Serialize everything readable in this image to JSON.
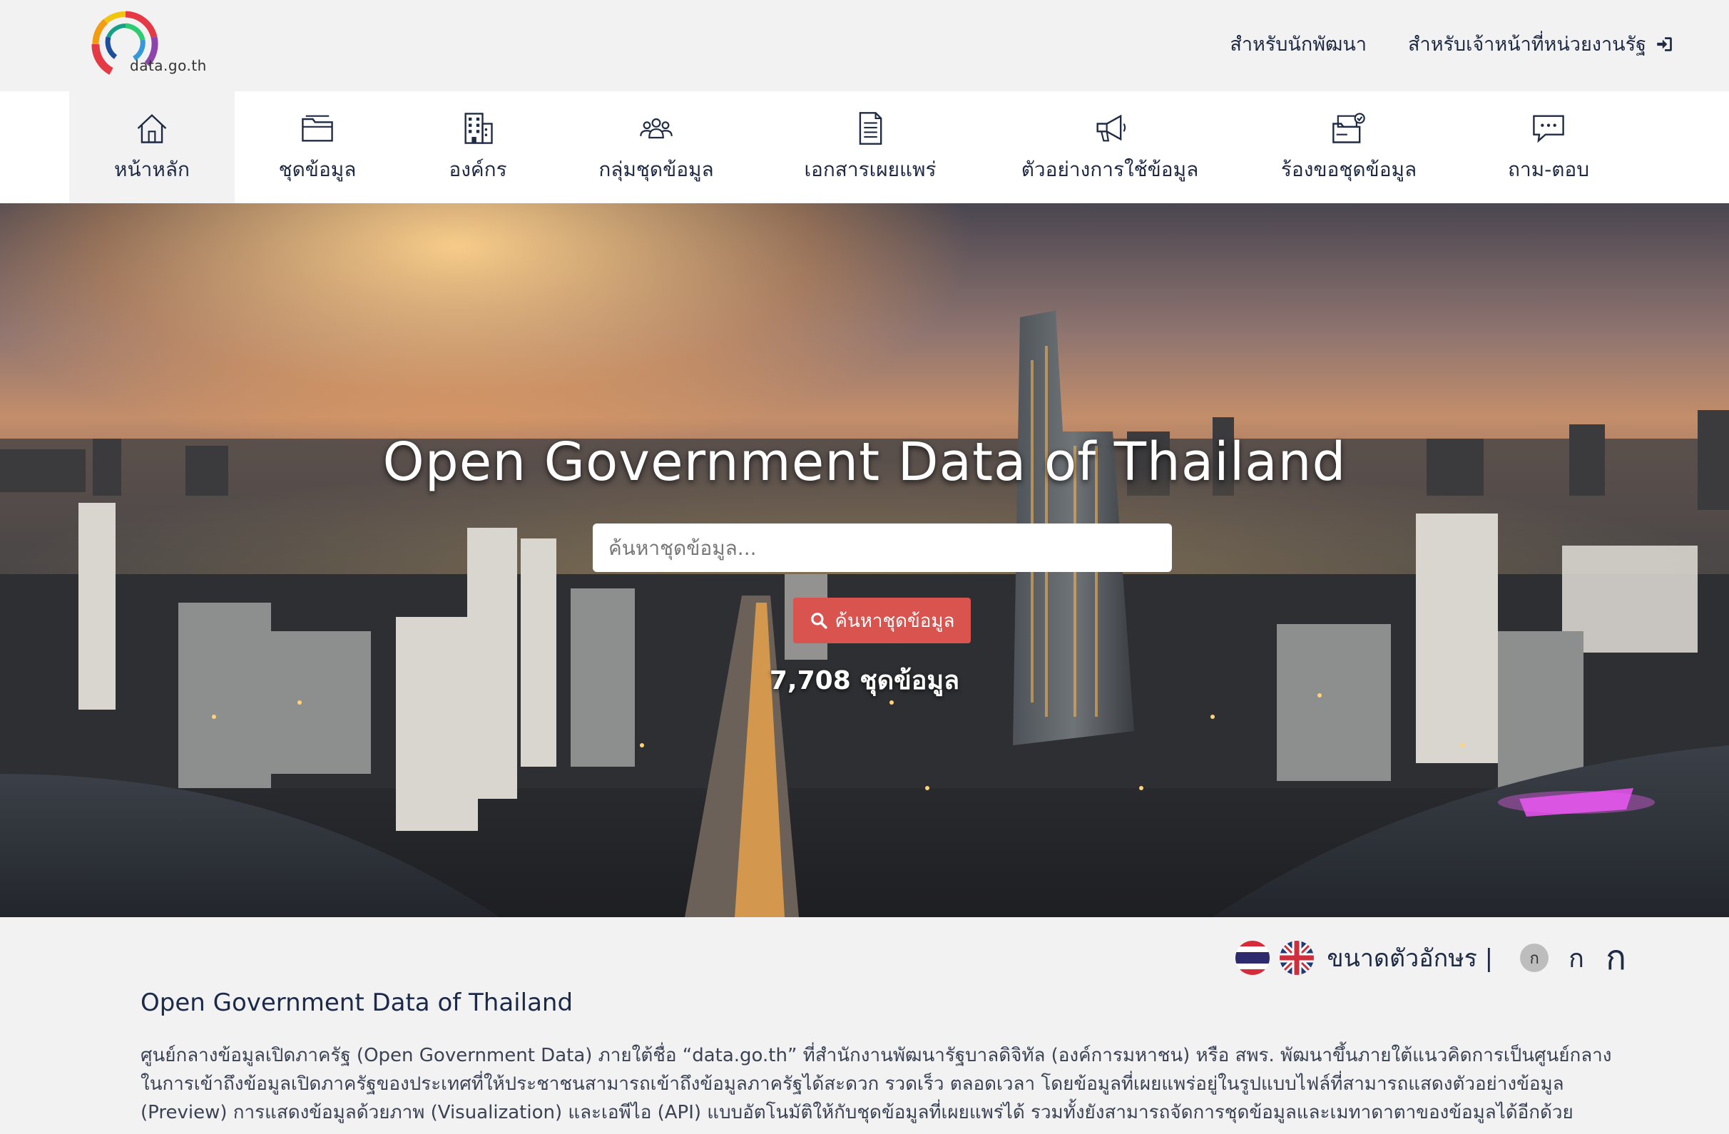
{
  "header": {
    "logo_text": "data.go.th",
    "links": [
      {
        "label": "สำหรับนักพัฒนา"
      },
      {
        "label": "สำหรับเจ้าหน้าที่หน่วยงานรัฐ"
      }
    ]
  },
  "nav": {
    "items": [
      {
        "label": "หน้าหลัก",
        "icon": "home-icon",
        "active": true
      },
      {
        "label": "ชุดข้อมูล",
        "icon": "folder-icon"
      },
      {
        "label": "องค์กร",
        "icon": "building-icon"
      },
      {
        "label": "กลุ่มชุดข้อมูล",
        "icon": "group-icon"
      },
      {
        "label": "เอกสารเผยแพร่",
        "icon": "document-icon"
      },
      {
        "label": "ตัวอย่างการใช้ข้อมูล",
        "icon": "megaphone-icon"
      },
      {
        "label": "ร้องขอชุดข้อมูล",
        "icon": "request-icon"
      },
      {
        "label": "ถาม-ตอบ",
        "icon": "chat-icon"
      }
    ]
  },
  "hero": {
    "title": "Open Government Data of Thailand",
    "search_placeholder": "ค้นหาชุดข้อมูล...",
    "search_button": "ค้นหาชุดข้อมูล",
    "count_text": "7,708 ชุดข้อมูล"
  },
  "tools": {
    "font_size_label": "ขนาดตัวอักษร |",
    "font_small": "ก",
    "font_mid": "ก",
    "font_big": "ก"
  },
  "about": {
    "title": "Open Government Data of Thailand",
    "text": "ศูนย์กลางข้อมูลเปิดภาครัฐ (Open Government Data) ภายใต้ชื่อ “data.go.th” ที่สำนักงานพัฒนารัฐบาลดิจิทัล (องค์การมหาชน) หรือ สพร. พัฒนาขึ้นภายใต้แนวคิดการเป็นศูนย์กลางในการเข้าถึงข้อมูลเปิดภาครัฐของประเทศที่ให้ประชาชนสามารถเข้าถึงข้อมูลภาครัฐได้สะดวก รวดเร็ว ตลอดเวลา โดยข้อมูลที่เผยแพร่อยู่ในรูปแบบไฟล์ที่สามารถแสดงตัวอย่างข้อมูล (Preview) การแสดงข้อมูลด้วยภาพ (Visualization) และเอพีไอ (API) แบบอัตโนมัติให้กับชุดข้อมูลที่เผยแพร่ได้ รวมทั้งยังสามารถจัดการชุดข้อมูลและเมทาดาตาของข้อมูลได้อีกด้วย"
  },
  "colors": {
    "primary_text": "#1f2a44",
    "search_button": "#d9534f",
    "nav_bg": "#ffffff",
    "page_bg": "#f2f2f2"
  }
}
